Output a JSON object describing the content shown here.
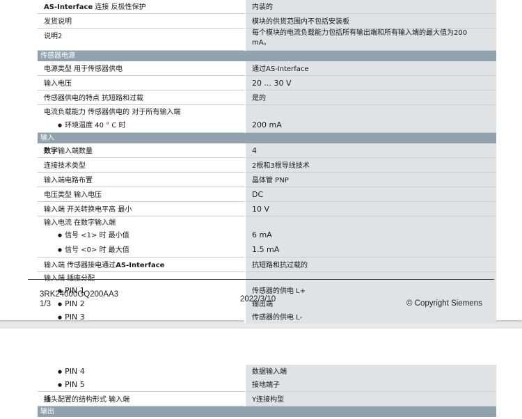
{
  "page1": {
    "rows": [
      {
        "label_html": "<b>AS-Interface</b> 连接 反极性保护",
        "value": "内装的",
        "h": 16
      },
      {
        "label": "发货说明",
        "value": "模块的供货范围内不包括安装板",
        "h": 18
      },
      {
        "label": "说明2",
        "value_lines": [
          "每个模块的电流负载能力包括所有输出端和所有输入端的最大值为200",
          "mA。"
        ],
        "h": 31
      },
      {
        "section": "传感器电源"
      },
      {
        "label": "电源类型 用于传感器供电",
        "value": "通过AS-Interface",
        "h": 17
      },
      {
        "label": "输入电压",
        "value": "20 ... 30 V",
        "h": 17
      },
      {
        "label": "传感器供电的特点 抗短路和过载",
        "value": "是的",
        "h": 17
      },
      {
        "label": "电流负载能力 传感器供电的 对于所有输入端",
        "value": "",
        "h": 15,
        "nosep": true
      },
      {
        "label": "环境温度 40 ° C 时",
        "bullet": true,
        "value": "200 mA",
        "h": 17
      },
      {
        "section": "输入"
      },
      {
        "label_html": "<b>数字</b>输入端数量",
        "value": "4",
        "h": 17
      },
      {
        "label": "连接技术类型",
        "value": "2根和3根导线技术",
        "h": 17
      },
      {
        "label": "输入端电路布置",
        "value": "晶体管 PNP",
        "h": 17
      },
      {
        "label": "电压类型 输入电压",
        "value": "DC",
        "h": 17
      },
      {
        "label": "输入端 开关转换电平高 最小",
        "value": "10 V",
        "h": 17
      },
      {
        "label": "输入电流 在数字输入端",
        "value": "",
        "h": 13,
        "nosep": true
      },
      {
        "label": "信号 <1> 时 最小值",
        "bullet": true,
        "value": "6 mA",
        "h": 18,
        "nosep": true
      },
      {
        "label": "信号 <0> 时 最大值",
        "bullet": true,
        "value": "1.5 mA",
        "h": 18
      },
      {
        "label_html": "输入端 传感器接电通过<b>AS-Interface</b>",
        "value": "抗短路和抗过载的",
        "h": 18
      },
      {
        "label": "输入端 插座分配",
        "value": "",
        "h": 14,
        "nosep": true
      },
      {
        "label": "PIN 1",
        "bullet": true,
        "value": "传感器的供电 L+",
        "h": 16,
        "nosep": true
      },
      {
        "label": "PIN 2",
        "bullet": true,
        "value": "输出端",
        "h": 16,
        "nosep": true
      },
      {
        "label": "PIN 3",
        "bullet": true,
        "value": "传感器的供电 L-",
        "h": 16,
        "nosep": true
      }
    ],
    "footer": {
      "product_id": "3RK24000GQ200AA3",
      "page": "1/3",
      "date": "2022/3/10",
      "copyright": "© Copyright Siemens"
    }
  },
  "page2": {
    "rows": [
      {
        "label": "PIN 4",
        "bullet": true,
        "value": "数据输入端",
        "h": 16,
        "nosep": true
      },
      {
        "label": "PIN 5",
        "bullet": true,
        "value": "接地端子",
        "h": 16
      },
      {
        "label_html": "<b>插</b>头配置的结构形式 输入端",
        "value": "Y连接构型",
        "h": 17
      },
      {
        "section": "输出"
      }
    ]
  }
}
